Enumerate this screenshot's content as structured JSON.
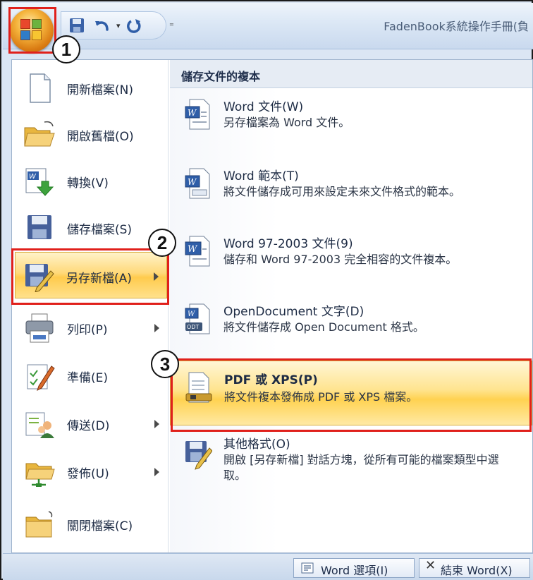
{
  "window": {
    "title": "FadenBook系統操作手冊(負"
  },
  "quick_access": {
    "icons": [
      "save-icon",
      "undo-icon",
      "dropdown-arrow-icon",
      "redo-icon",
      "customize-dropdown-icon"
    ]
  },
  "callouts": {
    "one": "1",
    "two": "2",
    "three": "3"
  },
  "left_menu": {
    "items": [
      {
        "label": "開新檔案(N)",
        "icon": "new-document-icon"
      },
      {
        "label": "開啟舊檔(O)",
        "icon": "open-folder-icon"
      },
      {
        "label": "轉換(V)",
        "icon": "convert-icon"
      },
      {
        "label": "儲存檔案(S)",
        "icon": "save-icon"
      },
      {
        "label": "另存新檔(A)",
        "icon": "save-as-icon"
      },
      {
        "label": "列印(P)",
        "icon": "print-icon"
      },
      {
        "label": "準備(E)",
        "icon": "prepare-icon"
      },
      {
        "label": "傳送(D)",
        "icon": "send-icon"
      },
      {
        "label": "發佈(U)",
        "icon": "publish-icon"
      },
      {
        "label": "關閉檔案(C)",
        "icon": "close-folder-icon"
      }
    ]
  },
  "right_panel": {
    "header": "儲存文件的複本",
    "items": [
      {
        "title": "Word 文件(W)",
        "desc": "另存檔案為 Word 文件。"
      },
      {
        "title": "Word 範本(T)",
        "desc": "將文件儲存成可用來設定未來文件格式的範本。"
      },
      {
        "title": "Word 97-2003 文件(9)",
        "desc": "儲存和 Word 97-2003 完全相容的文件複本。"
      },
      {
        "title": "OpenDocument 文字(D)",
        "desc": "將文件儲存成 Open Document 格式。"
      },
      {
        "title": "PDF 或 XPS(P)",
        "desc": "將文件複本發佈成 PDF 或 XPS 檔案。"
      },
      {
        "title": "其他格式(O)",
        "desc": "開啟 [另存新檔] 對話方塊，從所有可能的檔案類型中選取。"
      }
    ]
  },
  "bottom": {
    "options_label": "Word 選項(I)",
    "exit_label": "結束 Word(X)"
  },
  "colors": {
    "highlight_red": "#e0201b",
    "active_gold": "#ffd251"
  }
}
